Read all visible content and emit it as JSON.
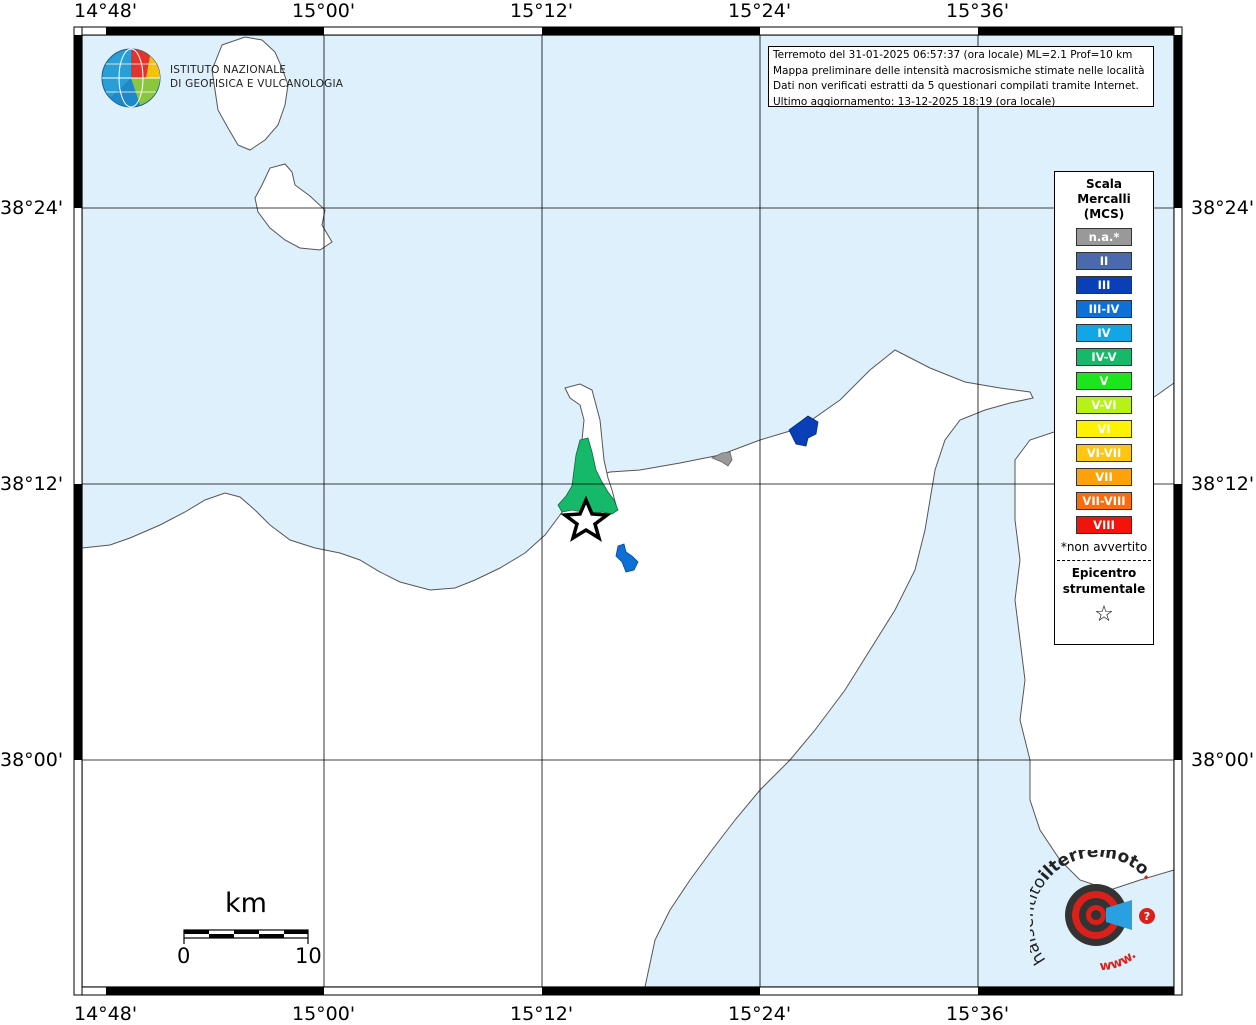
{
  "map": {
    "lon_labels": [
      "14°48'",
      "15°00'",
      "15°12'",
      "15°24'",
      "15°36'"
    ],
    "lat_labels": [
      "38°24'",
      "38°12'",
      "38°00'"
    ],
    "colors": {
      "sea": "#dff0fd",
      "land": "#ffffff",
      "coast": "#555555",
      "grid": "#000000"
    }
  },
  "logo": {
    "institute_line1": "ISTITUTO NAZIONALE",
    "institute_line2": "DI GEOFISICA E VULCANOLOGIA"
  },
  "info": {
    "line1": "Terremoto del 31-01-2025 06:57:37 (ora locale) ML=2.1 Prof=10 km",
    "line2": "Mappa preliminare delle intensità macrosismiche stimate nelle località",
    "line3": "Dati non verificati estratti da 5 questionari compilati tramite Internet.",
    "line4": "Ultimo aggiornamento: 13-12-2025 18:19 (ora locale)"
  },
  "legend": {
    "title_line1": "Scala",
    "title_line2": "Mercalli",
    "title_line3": "(MCS)",
    "items": [
      {
        "label": "n.a.*",
        "color": "#999999"
      },
      {
        "label": "II",
        "color": "#4a6aad"
      },
      {
        "label": "III",
        "color": "#0a3fb8"
      },
      {
        "label": "III-IV",
        "color": "#0d6fd8"
      },
      {
        "label": "IV",
        "color": "#12a6e6"
      },
      {
        "label": "IV-V",
        "color": "#16b86a"
      },
      {
        "label": "V",
        "color": "#1be61b"
      },
      {
        "label": "V-VI",
        "color": "#b6f21a"
      },
      {
        "label": "VI",
        "color": "#fff200"
      },
      {
        "label": "VI-VII",
        "color": "#ffc414"
      },
      {
        "label": "VII",
        "color": "#ffa10a"
      },
      {
        "label": "VII-VIII",
        "color": "#ff6a0a"
      },
      {
        "label": "VIII",
        "color": "#f2140a"
      }
    ],
    "note": "*non avvertito",
    "epicenter_line1": "Epicentro",
    "epicenter_line2": "strumentale",
    "epicenter_symbol": "☆"
  },
  "scale_bar": {
    "unit": "km",
    "start": "0",
    "end": "10"
  },
  "hsit_logo": {
    "text_a": "haisentito",
    "text_b": "ilterremoto",
    "text_c": ".it",
    "text_d": "www."
  }
}
